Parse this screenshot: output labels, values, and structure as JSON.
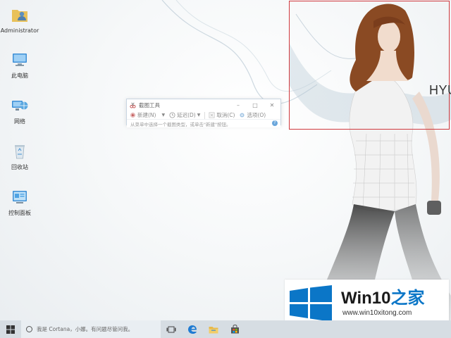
{
  "desktop": {
    "icons": [
      {
        "name": "Administrator",
        "icon": "user-folder-icon"
      },
      {
        "name": "此电脑",
        "icon": "computer-icon"
      },
      {
        "name": "网络",
        "icon": "network-icon"
      },
      {
        "name": "回收站",
        "icon": "recycle-bin-icon"
      },
      {
        "name": "控制面板",
        "icon": "control-panel-icon"
      }
    ]
  },
  "snipping_tool": {
    "title": "截图工具",
    "buttons": {
      "new": "新建(N)",
      "delay": "延迟(D)",
      "cancel": "取消(C)",
      "options": "选项(O)"
    },
    "window_controls": {
      "minimize": "–",
      "maximize": "□",
      "close": "✕"
    },
    "status_text": "从菜单中选择一个截图类型，或单击\"新建\"按钮。",
    "help": "?"
  },
  "wallpaper": {
    "brand_text": "HYU"
  },
  "watermark": {
    "title_part1": "Win10",
    "title_part2": "之家",
    "url": "www.win10xitong.com"
  },
  "taskbar": {
    "cortana_placeholder": "我是 Cortana，小娜。有问题尽管问我。",
    "apps": [
      "task-view-icon",
      "edge-icon",
      "file-explorer-icon",
      "store-icon"
    ]
  },
  "colors": {
    "selection_border": "#d0393e",
    "win_blue": "#0b76c7",
    "taskbar": "#d6dde3"
  }
}
